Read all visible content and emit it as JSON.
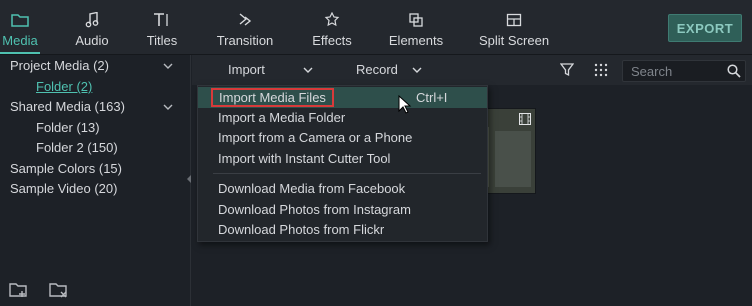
{
  "nav": {
    "tabs": [
      {
        "label": "Media",
        "icon": "folder-icon",
        "active": true
      },
      {
        "label": "Audio",
        "icon": "music-note-icon"
      },
      {
        "label": "Titles",
        "icon": "text-cursor-icon"
      },
      {
        "label": "Transition",
        "icon": "transition-icon"
      },
      {
        "label": "Effects",
        "icon": "effects-icon"
      },
      {
        "label": "Elements",
        "icon": "elements-icon"
      },
      {
        "label": "Split Screen",
        "icon": "split-screen-icon"
      }
    ],
    "export_label": "EXPORT"
  },
  "sidebar": {
    "items": [
      {
        "label": "Project Media (2)"
      },
      {
        "label": "Folder (2)"
      },
      {
        "label": "Shared Media (163)"
      },
      {
        "label": "Folder (13)"
      },
      {
        "label": "Folder 2 (150)"
      },
      {
        "label": "Sample Colors (15)"
      },
      {
        "label": "Sample Video (20)"
      }
    ]
  },
  "toolbar": {
    "import_label": "Import",
    "record_label": "Record",
    "search_placeholder": "Search"
  },
  "import_menu": {
    "items": [
      {
        "label": "Import Media Files",
        "shortcut": "Ctrl+I"
      },
      {
        "label": "Import a Media Folder"
      },
      {
        "label": "Import from a Camera or a Phone"
      },
      {
        "label": "Import with Instant Cutter Tool"
      },
      {
        "label": "Download Media from Facebook"
      },
      {
        "label": "Download Photos from Instagram"
      },
      {
        "label": "Download Photos from Flickr"
      }
    ]
  },
  "colors": {
    "accent": "#4fc1b0",
    "highlight_border": "#d83a3a",
    "background": "#1d2127"
  }
}
